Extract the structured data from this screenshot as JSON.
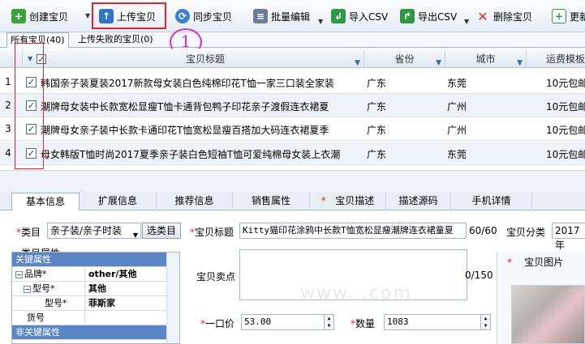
{
  "toolbar": {
    "create": "创建宝贝",
    "upload": "上传宝贝",
    "sync": "同步宝贝",
    "batch_edit": "批量编辑",
    "import_csv": "导入CSV",
    "export_csv": "导出CSV",
    "delete": "删除宝贝",
    "more": "更新"
  },
  "subtabs": {
    "all": "所有宝贝(40)",
    "failed": "上传失败的宝贝(0)"
  },
  "annotation": "1",
  "grid": {
    "headers": {
      "title": "宝贝标题",
      "province": "省份",
      "city": "城市",
      "shipping": "运费模板"
    },
    "rows": [
      {
        "num": "1",
        "title": "韩国亲子装夏装2017新款母女装白色纯棉印花T恤一家三口装全家装",
        "province": "广东",
        "city": "东莞",
        "shipping": "10元包邮"
      },
      {
        "num": "2",
        "title": "潮牌母女装中长款宽松显瘦T恤卡通背包鸭子印花亲子渡假连衣裙夏",
        "province": "广东",
        "city": "广州",
        "shipping": "10元包邮"
      },
      {
        "num": "3",
        "title": "潮牌母女亲子装中长款卡通印花T恤宽松显瘦百搭加大码连衣裙夏季",
        "province": "广东",
        "city": "广州",
        "shipping": "10元包邮"
      },
      {
        "num": "4",
        "title": "母女韩版T恤时尚2017夏季亲子装白色短袖T恤可爱纯棉母女装上衣潮",
        "province": "广东",
        "city": "东莞",
        "shipping": "10元包邮"
      }
    ]
  },
  "detail_tabs": [
    {
      "label": "基本信息",
      "required": false
    },
    {
      "label": "扩展信息",
      "required": false
    },
    {
      "label": "推荐信息",
      "required": false
    },
    {
      "label": "销售属性",
      "required": false
    },
    {
      "label": "宝贝描述",
      "required": true
    },
    {
      "label": "描述源码",
      "required": false
    },
    {
      "label": "手机详情",
      "required": false
    }
  ],
  "form": {
    "category_label": "类目",
    "category_value": "亲子装/亲子时装",
    "choose_category": "选类目",
    "title_label": "宝贝标题",
    "title_value": "Kitty猫印花涂鸦中长款T恤宽松显瘦潮牌连衣裙童夏",
    "title_count": "60/60",
    "classify_label": "宝贝分类",
    "classify_value": "2017年",
    "attr_group": "类目属性",
    "selling_label": "宝贝卖点",
    "selling_count": "0/150",
    "image_label": "宝贝图片",
    "price_label": "一口价",
    "price_value": "53.00",
    "qty_label": "数量",
    "qty_value": "1083",
    "props": [
      {
        "key": "关键属性",
        "value": "",
        "section": true
      },
      {
        "key": "品牌*",
        "value": "other/其他",
        "section": false,
        "indent": 0,
        "expander": "−"
      },
      {
        "key": "型号*",
        "value": "其他",
        "section": false,
        "indent": 1,
        "expander": "−"
      },
      {
        "key": "型号*",
        "value": "菲斯家",
        "section": false,
        "indent": 2,
        "expander": ""
      },
      {
        "key": "货号",
        "value": "",
        "section": false,
        "indent": 1,
        "expander": ""
      },
      {
        "key": "非关键属性",
        "value": "",
        "section": true
      }
    ]
  },
  "watermark": "www.          .com",
  "colors": {
    "highlight": "#e8242a",
    "annotation": "#d233c9",
    "section": "#5b86c5"
  }
}
